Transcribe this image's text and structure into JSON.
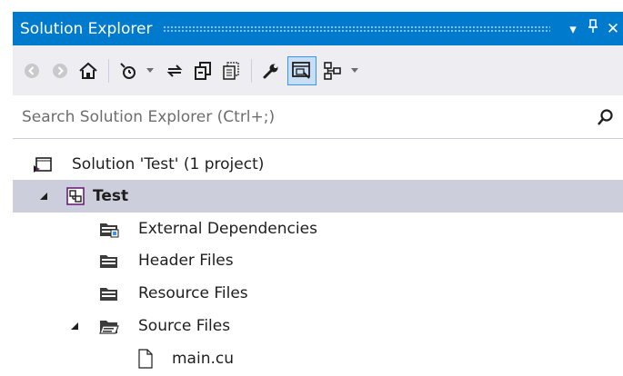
{
  "window": {
    "title": "Solution Explorer",
    "pin_glyph": "⫫",
    "close_glyph": "✕",
    "dropdown_glyph": "▾"
  },
  "toolbar": {
    "buttons": [
      "back-icon",
      "forward-icon",
      "home-icon",
      "pending-changes-filter-icon",
      "sync-with-active-document-icon",
      "collapse-all-icon",
      "show-all-files-icon",
      "properties-icon",
      "preview-selected-items-icon",
      "class-view-icon"
    ],
    "active_button": "preview-selected-items-icon",
    "accent_color": "#3399ff"
  },
  "search": {
    "placeholder": "Search Solution Explorer (Ctrl+;)"
  },
  "tree": {
    "solution": {
      "label": "Solution 'Test' (1 project)"
    },
    "project": {
      "label": "Test",
      "expanded": true,
      "selected": true
    },
    "folders": [
      {
        "label": "External Dependencies",
        "expanded": false
      },
      {
        "label": "Header Files",
        "expanded": false
      },
      {
        "label": "Resource Files",
        "expanded": false
      },
      {
        "label": "Source Files",
        "expanded": true
      }
    ],
    "files": [
      {
        "label": "main.cu"
      }
    ]
  },
  "colors": {
    "title_bar": "#007acc",
    "toolbar_bg": "#eeeef2",
    "selection_bg": "#cccedb"
  }
}
